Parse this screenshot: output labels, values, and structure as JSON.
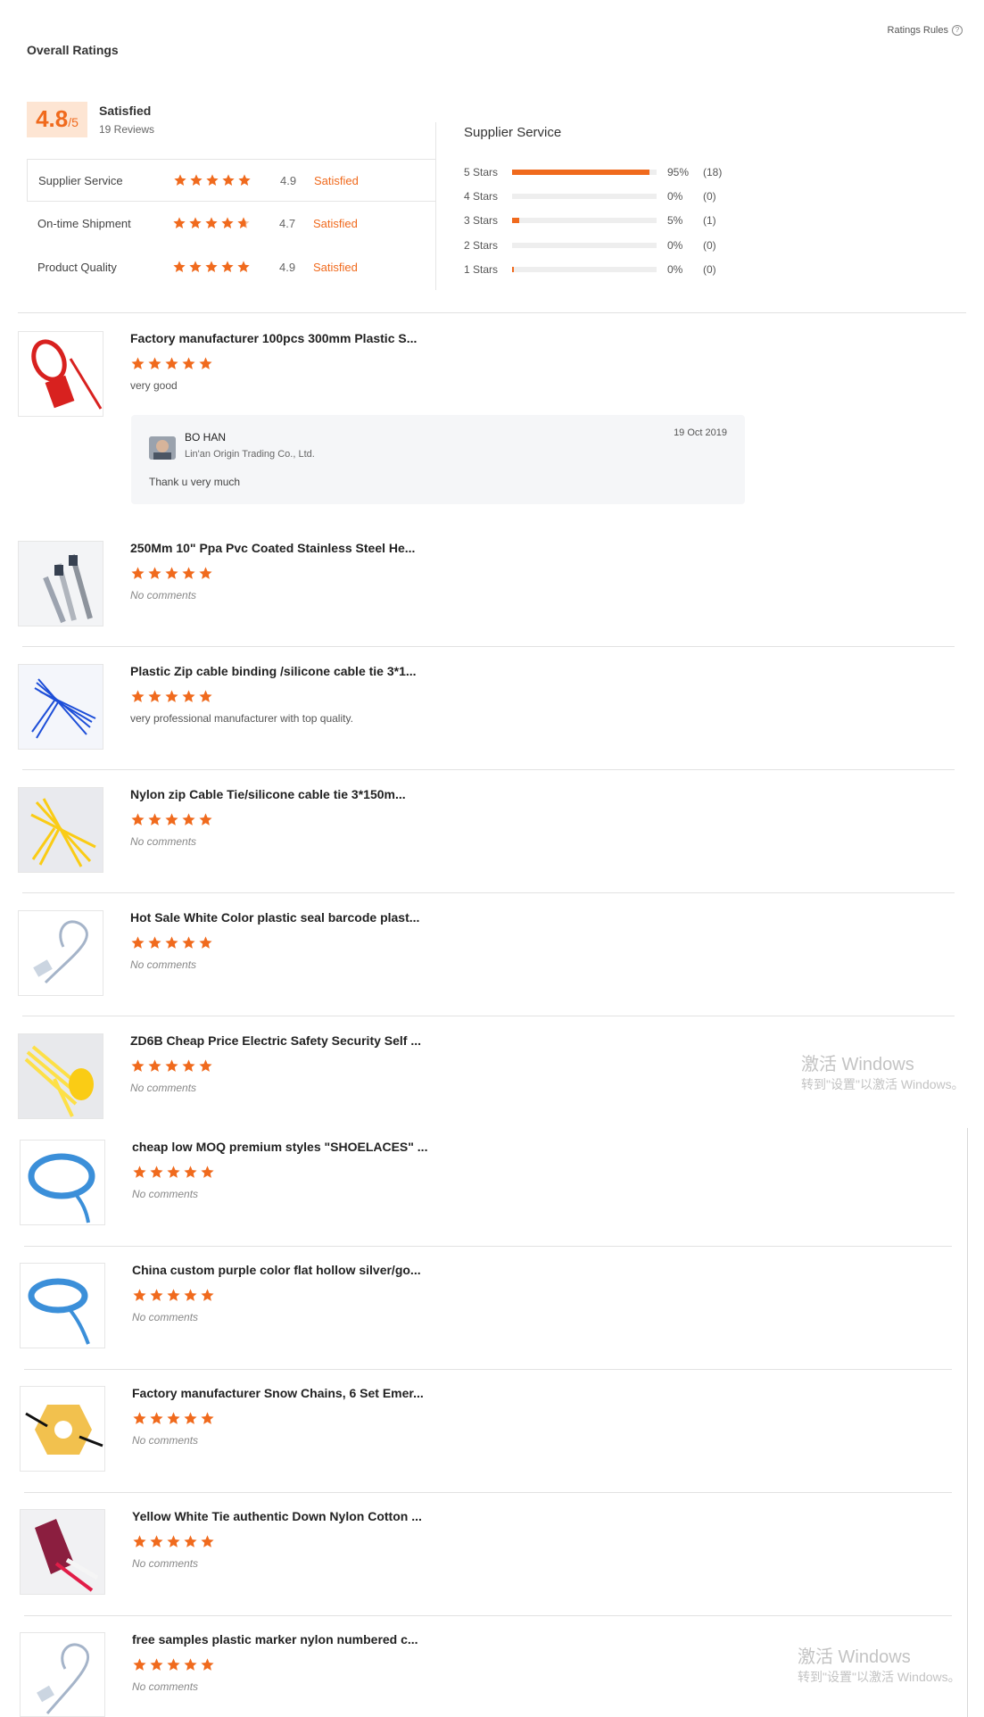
{
  "header": {
    "title": "Overall Ratings",
    "rules_label": "Ratings Rules",
    "rules_icon": "question-circle-icon"
  },
  "summary": {
    "score": "4.8",
    "score_suffix": "/5",
    "label": "Satisfied",
    "reviews": "19 Reviews",
    "rows": [
      {
        "label": "Supplier Service",
        "stars": 5,
        "value": "4.9",
        "status": "Satisfied"
      },
      {
        "label": "On-time Shipment",
        "stars": 4.7,
        "value": "4.7",
        "status": "Satisfied"
      },
      {
        "label": "Product Quality",
        "stars": 5,
        "value": "4.9",
        "status": "Satisfied"
      }
    ]
  },
  "distribution": {
    "title": "Supplier Service",
    "rows": [
      {
        "label": "5 Stars",
        "fraction": 0.95,
        "pct": "95%",
        "count": "(18)"
      },
      {
        "label": "4 Stars",
        "fraction": 0.0,
        "pct": "0%",
        "count": "(0)"
      },
      {
        "label": "3 Stars",
        "fraction": 0.05,
        "pct": "5%",
        "count": "(1)"
      },
      {
        "label": "2 Stars",
        "fraction": 0.0,
        "pct": "0%",
        "count": "(0)"
      },
      {
        "label": "1 Stars",
        "fraction": 0.0,
        "pct": "0%",
        "count": "(0)"
      }
    ]
  },
  "reviews": [
    {
      "title": "Factory manufacturer 100pcs 300mm Plastic S...",
      "comment": "very good",
      "no_comment": false
    },
    {
      "title": "250Mm 10\" Ppa Pvc Coated Stainless Steel He...",
      "comment": "No comments",
      "no_comment": true
    },
    {
      "title": "Plastic Zip cable binding /silicone cable tie 3*1...",
      "comment": "very professional manufacturer with top quality.",
      "no_comment": false
    },
    {
      "title": "Nylon zip Cable Tie/silicone cable tie 3*150m...",
      "comment": "No comments",
      "no_comment": true
    },
    {
      "title": "Hot Sale White Color plastic seal barcode plast...",
      "comment": "No comments",
      "no_comment": true
    },
    {
      "title": "ZD6B Cheap Price Electric Safety Security Self ...",
      "comment": "No comments",
      "no_comment": true
    },
    {
      "title": "cheap low MOQ premium styles \"SHOELACES\" ...",
      "comment": "No comments",
      "no_comment": true
    },
    {
      "title": "China custom purple color flat hollow silver/go...",
      "comment": "No comments",
      "no_comment": true
    },
    {
      "title": "Factory manufacturer Snow Chains, 6 Set Emer...",
      "comment": "No comments",
      "no_comment": true
    },
    {
      "title": "Yellow White Tie authentic Down Nylon Cotton ...",
      "comment": "No comments",
      "no_comment": true
    },
    {
      "title": "free samples plastic marker nylon numbered c...",
      "comment": "No comments",
      "no_comment": true
    }
  ],
  "reply": {
    "name": "BO HAN",
    "company": "Lin'an Origin Trading Co., Ltd.",
    "date": "19 Oct 2019",
    "message": "Thank u very much"
  },
  "watermark": {
    "title": "激活 Windows",
    "subtitle": "转到\"设置\"以激活 Windows。"
  },
  "colors": {
    "accent": "#f06a1d",
    "badge_bg": "#fde5d3"
  }
}
